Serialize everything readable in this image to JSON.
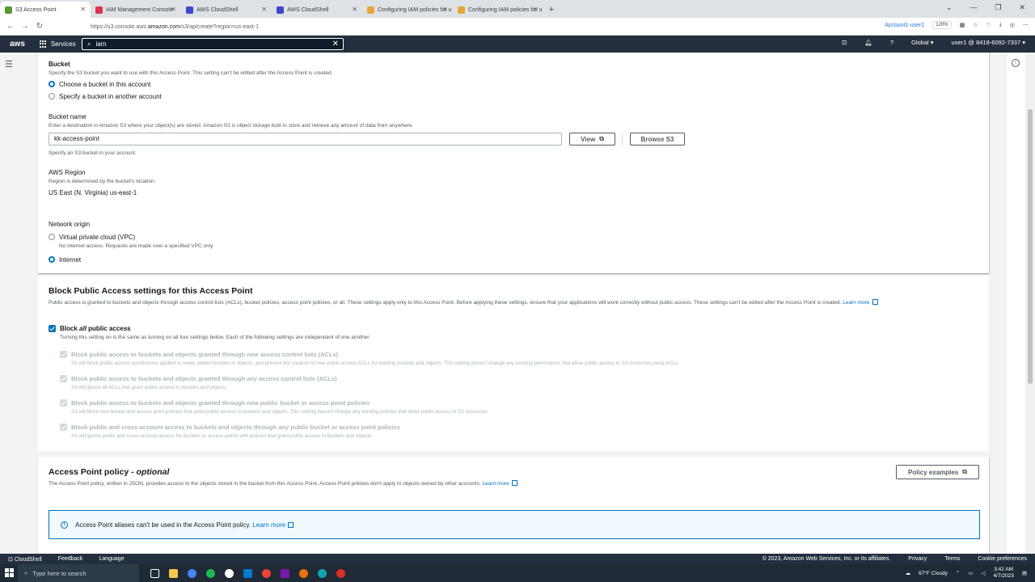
{
  "browser": {
    "tabs": [
      {
        "label": "S3 Access Point",
        "active": true,
        "color": "#569a31"
      },
      {
        "label": "IAM Management Console",
        "active": false,
        "color": "#dd344c"
      },
      {
        "label": "AWS CloudShell",
        "active": false,
        "color": "#3b48cc"
      },
      {
        "label": "AWS CloudShell",
        "active": false,
        "color": "#3b48cc"
      },
      {
        "label": "Configuring IAM policies for u",
        "active": false,
        "color": "#e8a33d"
      },
      {
        "label": "Configuring IAM policies for u",
        "active": false,
        "color": "#e8a33d"
      }
    ],
    "url_prefix": "https://s3.console.aws.",
    "url_domain": "amazon.com",
    "url_path": "/s3/ap/create?region=us-east-1",
    "account_pill": "Account1-user1",
    "zoom": "120%"
  },
  "aws_nav": {
    "logo": "aws",
    "services": "Services",
    "search_value": "iam",
    "region": "Global",
    "account": "user1 @ 8418-6092-7337"
  },
  "bucket": {
    "label": "Bucket",
    "description": "Specify the S3 bucket you want to use with this Access Point. This setting can't be edited after the Access Point is created",
    "option_this_account": "Choose a bucket in this account",
    "option_other_account": "Specify a bucket in another account",
    "name_label": "Bucket name",
    "name_description": "Enter a destination in Amazon S3 where your object(s) are stored. Amazon S3 is object storage built to store and retrieve any amount of data from anywhere.",
    "name_value": "kk-access-point",
    "name_hint": "Specify an S3 bucket in your account.",
    "view_button": "View",
    "browse_button": "Browse S3"
  },
  "region": {
    "label": "AWS Region",
    "description": "Region is determined by the bucket's location.",
    "value": "US East (N. Virginia) us-east-1"
  },
  "network": {
    "label": "Network origin",
    "vpc_option": "Virtual private cloud (VPC)",
    "vpc_description": "No internet access. Requests are made over a specified VPC only.",
    "internet_option": "Internet"
  },
  "block_public": {
    "title": "Block Public Access settings for this Access Point",
    "description": "Public access is granted to buckets and objects through access control lists (ACLs), bucket policies, access point policies, or all. These settings apply only to this Access Point. Before applying these settings, ensure that your applications will work correctly without public access. These settings can't be edited after the Access Point is created.",
    "learn_more": "Learn more",
    "block_all_pre": "Block ",
    "block_all_em": "all",
    "block_all_post": " public access",
    "block_all_desc": "Turning this setting on is the same as turning on all four settings below. Each of the following settings are independent of one another.",
    "settings": [
      {
        "pre": "Block public access to buckets and objects granted through ",
        "em": "new",
        "post": " access control lists (ACLs)",
        "desc": "S3 will block public access permissions applied to newly added buckets or objects, and prevent the creation of new public access ACLs for existing buckets and objects. This setting doesn't change any existing permissions that allow public access to S3 resources using ACLs."
      },
      {
        "pre": "Block public access to buckets and objects granted through ",
        "em": "any",
        "post": " access control lists (ACLs)",
        "desc": "S3 will ignore all ACLs that grant public access to buckets and objects."
      },
      {
        "pre": "Block public access to buckets and objects granted through ",
        "em": "new",
        "post": " public bucket or access point policies",
        "desc": "S3 will block new bucket and access point policies that grant public access to buckets and objects. This setting doesn't change any existing policies that allow public access to S3 resources."
      },
      {
        "pre": "Block public and cross-account access to buckets and objects through ",
        "em": "any",
        "post": " public bucket or access point policies",
        "desc": "S3 will ignore public and cross-account access for buckets or access points with policies that grant public access to buckets and objects."
      }
    ]
  },
  "policy": {
    "title": "Access Point policy - ",
    "title_em": "optional",
    "description": "The Access Point policy, written in JSON, provides access to the objects stored in the bucket from this Access Point. Access Point policies don't apply to objects owned by other accounts.",
    "learn_more": "Learn more",
    "examples_button": "Policy examples",
    "alert_text": "Access Point aliases can't be used in the Access Point policy.",
    "alert_link": "Learn more"
  },
  "footer": {
    "cloudshell": "CloudShell",
    "feedback": "Feedback",
    "language": "Language",
    "copyright": "© 2023, Amazon Web Services, Inc. or its affiliates.",
    "privacy": "Privacy",
    "terms": "Terms",
    "cookies": "Cookie preferences"
  },
  "taskbar": {
    "search": "Type here to search",
    "weather": "67°F Cloudy",
    "time": "3:42 AM",
    "date": "4/7/2023"
  }
}
